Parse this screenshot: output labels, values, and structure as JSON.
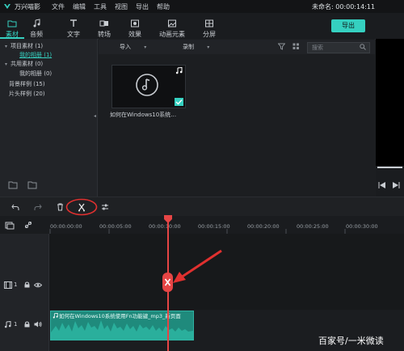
{
  "app": {
    "name": "万兴喵影",
    "project_title": "未命名: 00:00:14:11"
  },
  "menu": [
    "文件",
    "编辑",
    "工具",
    "视图",
    "导出",
    "帮助"
  ],
  "tabs": [
    {
      "label": "素材",
      "icon": "folder-icon",
      "active": true
    },
    {
      "label": "音频",
      "icon": "music-note-icon",
      "active": false
    },
    {
      "label": "文字",
      "icon": "text-icon",
      "active": false
    },
    {
      "label": "转场",
      "icon": "transition-icon",
      "active": false
    },
    {
      "label": "效果",
      "icon": "effects-icon",
      "active": false
    },
    {
      "label": "动画元素",
      "icon": "elements-icon",
      "active": false
    },
    {
      "label": "分屏",
      "icon": "split-screen-icon",
      "active": false
    }
  ],
  "export_label": "导出",
  "library": {
    "items": [
      {
        "label": "项目素材 (1)"
      },
      {
        "label": "我的相册 (1)"
      },
      {
        "label": "共用素材 (0)"
      },
      {
        "label": "我的相册 (0)"
      },
      {
        "label": "背景样例 (15)"
      },
      {
        "label": "片头样例 (20)"
      }
    ]
  },
  "media_bar": {
    "import": "导入",
    "record": "录制",
    "search_placeholder": "搜索"
  },
  "media": {
    "caption": "如何在Windows10系统…"
  },
  "ruler": {
    "ticks": [
      "00:00:00:00",
      "00:00:05:00",
      "00:00:10:00",
      "00:00:15:00",
      "00:00:20:00",
      "00:00:25:00",
      "00:00:30:00"
    ]
  },
  "tracks": {
    "video_label": "1",
    "audio_label": "1"
  },
  "audio_clip": {
    "label": "如何在Windows10系统使用Fn功能键_mp3_新页面"
  },
  "colors": {
    "accent": "#35d0c0",
    "playhead": "#e64545",
    "annotation": "#e0302f"
  },
  "watermark": "百家号/一米微读"
}
